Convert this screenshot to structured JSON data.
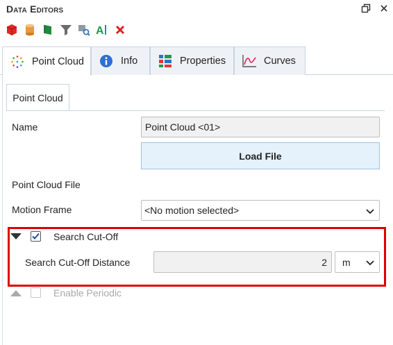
{
  "panel": {
    "title": "Data Editors",
    "restore_icon": "restore-window-icon",
    "close_icon": "close-icon"
  },
  "toolbar": {
    "icons": [
      "red-cube-icon",
      "orange-cylinder-icon",
      "green-flag-icon",
      "filter-funnel-icon",
      "find-object-icon",
      "text-label-icon",
      "delete-x-icon"
    ]
  },
  "tabs": [
    {
      "label": "Point Cloud",
      "icon": "point-cloud-icon",
      "active": true
    },
    {
      "label": "Info",
      "icon": "info-icon",
      "active": false
    },
    {
      "label": "Properties",
      "icon": "properties-grid-icon",
      "active": false
    },
    {
      "label": "Curves",
      "icon": "curves-chart-icon",
      "active": false
    }
  ],
  "subtab": {
    "label": "Point Cloud"
  },
  "form": {
    "name_label": "Name",
    "name_value": "Point Cloud <01>",
    "load_button": "Load File",
    "file_label": "Point Cloud File",
    "motion_label": "Motion Frame",
    "motion_value": "<No motion selected>",
    "cutoff_checkbox_label": "Search Cut-Off",
    "cutoff_checked": true,
    "cutoff_distance_label": "Search Cut-Off Distance",
    "cutoff_distance_value": "2",
    "cutoff_unit": "m",
    "periodic_label": "Enable Periodic",
    "periodic_checked": false
  },
  "colors": {
    "highlight": "#e00000",
    "accent": "#1e73be",
    "button_bg": "#e5f1fb"
  }
}
